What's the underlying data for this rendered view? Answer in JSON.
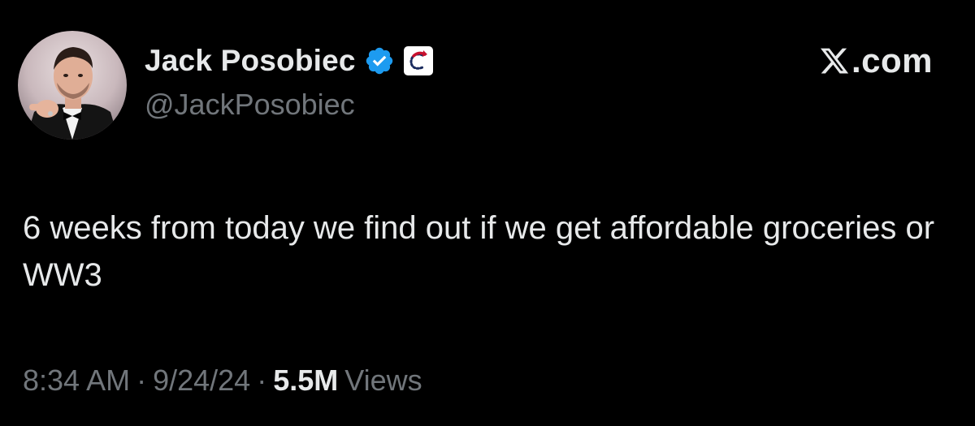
{
  "colors": {
    "background": "#000000",
    "primary_text": "#e7e9ea",
    "secondary_text": "#71767b",
    "verified_badge": "#1d9bf0"
  },
  "author": {
    "display_name": "Jack Posobiec",
    "handle": "@JackPosobiec",
    "avatar_icon": "profile-photo",
    "verified_icon": "verified-badge-icon",
    "affiliate_icon": "affiliate-logo-icon"
  },
  "brand": {
    "icon": "x-logo-icon",
    "text": ".com"
  },
  "tweet": {
    "text": "6 weeks from today we find out if we get affordable groceries or WW3"
  },
  "meta": {
    "time": "8:34 AM",
    "separator": "·",
    "date": "9/24/24",
    "views_count": "5.5M",
    "views_label": "Views"
  }
}
